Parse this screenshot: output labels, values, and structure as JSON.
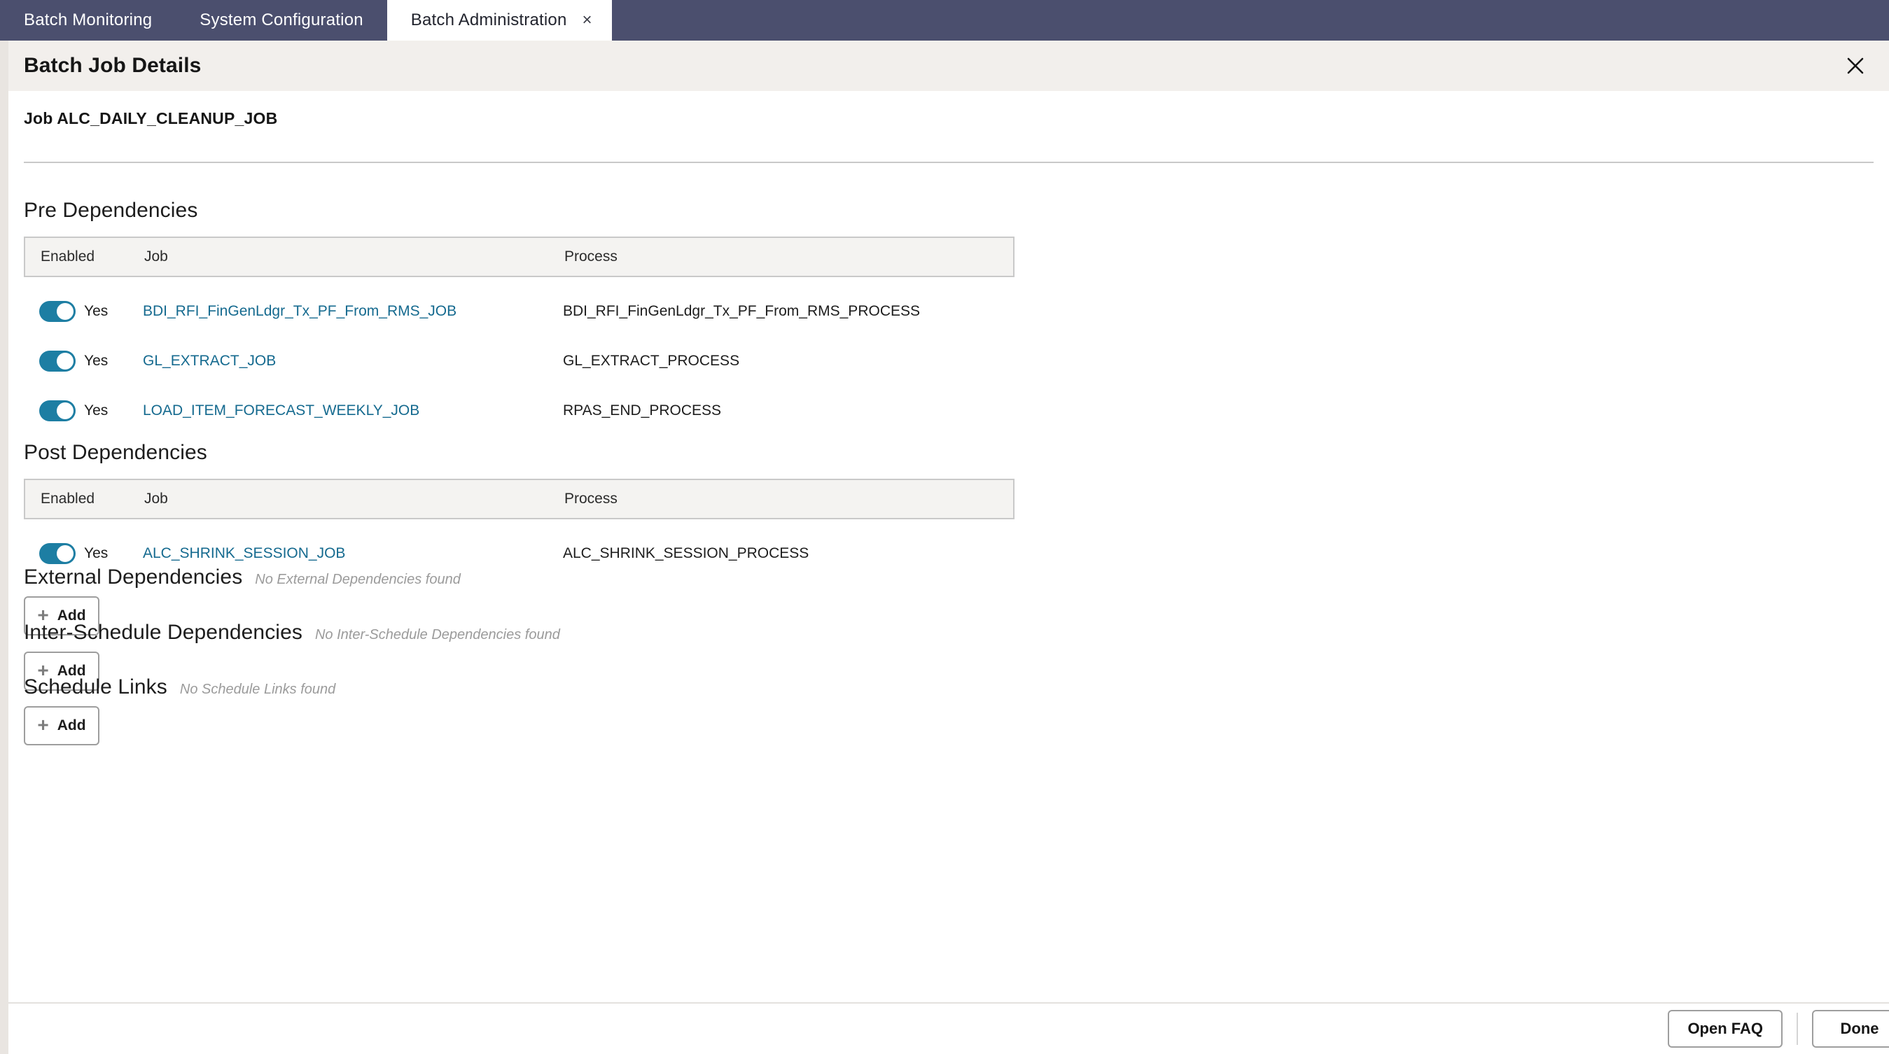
{
  "tabbar": {
    "tabs": [
      {
        "label": "Batch Monitoring",
        "active": false
      },
      {
        "label": "System Configuration",
        "active": false
      },
      {
        "label": "Batch Administration",
        "active": true,
        "close": "×"
      }
    ]
  },
  "dialog": {
    "title": "Batch Job Details",
    "close_icon": "close-icon",
    "job_line": "Job ALC_DAILY_CLEANUP_JOB"
  },
  "columns": {
    "enabled": "Enabled",
    "job": "Job",
    "process": "Process"
  },
  "pre_dependencies": {
    "title": "Pre Dependencies",
    "rows": [
      {
        "enabled": "Yes",
        "job": "BDI_RFI_FinGenLdgr_Tx_PF_From_RMS_JOB",
        "process": "BDI_RFI_FinGenLdgr_Tx_PF_From_RMS_PROCESS"
      },
      {
        "enabled": "Yes",
        "job": "GL_EXTRACT_JOB",
        "process": "GL_EXTRACT_PROCESS"
      },
      {
        "enabled": "Yes",
        "job": "LOAD_ITEM_FORECAST_WEEKLY_JOB",
        "process": "RPAS_END_PROCESS"
      }
    ]
  },
  "post_dependencies": {
    "title": "Post Dependencies",
    "rows": [
      {
        "enabled": "Yes",
        "job": "ALC_SHRINK_SESSION_JOB",
        "process": "ALC_SHRINK_SESSION_PROCESS"
      }
    ]
  },
  "external_dependencies": {
    "title": "External Dependencies",
    "empty_message": "No External Dependencies found",
    "add_label": "Add"
  },
  "inter_schedule_dependencies": {
    "title": "Inter-Schedule Dependencies",
    "empty_message": "No Inter-Schedule Dependencies found",
    "add_label": "Add"
  },
  "schedule_links": {
    "title": "Schedule Links",
    "empty_message": "No Schedule Links found",
    "add_label": "Add"
  },
  "footer": {
    "open_faq_label": "Open FAQ",
    "done_label": "Done"
  },
  "colors": {
    "tabbar_bg": "#4b4f6e",
    "header_bg": "#f2efec",
    "toggle_on": "#1d7ea3",
    "link": "#156a8f",
    "table_header_bg": "#f4f3f1",
    "border": "#c9c9c9"
  }
}
